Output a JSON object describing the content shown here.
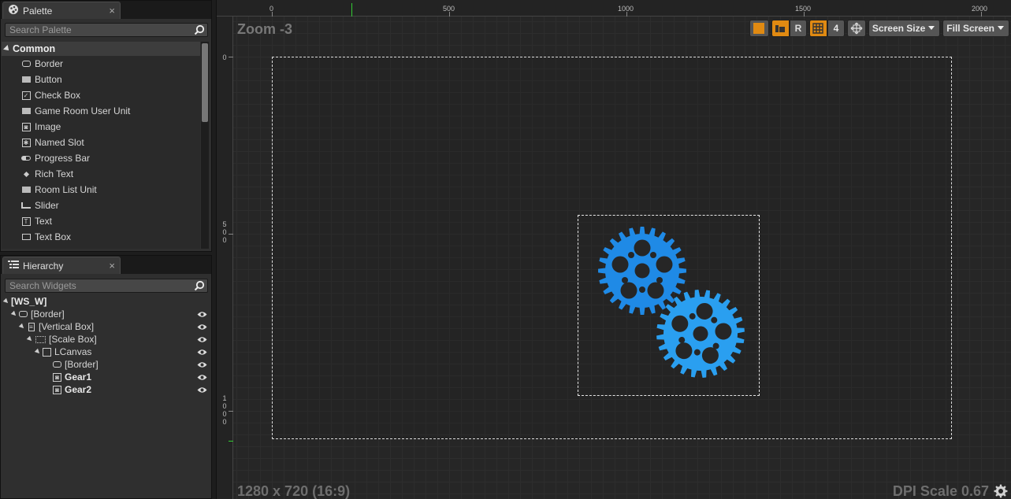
{
  "palette": {
    "tab_label": "Palette",
    "close": "×",
    "search_placeholder": "Search Palette",
    "category": "Common",
    "items": [
      {
        "label": "Border",
        "icon": "border-icon"
      },
      {
        "label": "Button",
        "icon": "button-icon"
      },
      {
        "label": "Check Box",
        "icon": "checkbox-icon"
      },
      {
        "label": "Game Room User Unit",
        "icon": "user-widget-icon"
      },
      {
        "label": "Image",
        "icon": "image-icon"
      },
      {
        "label": "Named Slot",
        "icon": "named-slot-icon"
      },
      {
        "label": "Progress Bar",
        "icon": "progress-bar-icon"
      },
      {
        "label": "Rich Text",
        "icon": "rich-text-icon"
      },
      {
        "label": "Room List Unit",
        "icon": "user-widget-icon"
      },
      {
        "label": "Slider",
        "icon": "slider-icon"
      },
      {
        "label": "Text",
        "icon": "text-icon"
      },
      {
        "label": "Text Box",
        "icon": "text-box-icon"
      }
    ]
  },
  "hierarchy": {
    "tab_label": "Hierarchy",
    "close": "×",
    "search_placeholder": "Search Widgets",
    "items": [
      {
        "label": "[WS_W]",
        "bold": true
      },
      {
        "label": "[Border]"
      },
      {
        "label": "[Vertical Box]"
      },
      {
        "label": "[Scale Box]"
      },
      {
        "label": "LCanvas"
      },
      {
        "label": "[Border]"
      },
      {
        "label": "Gear1",
        "bold": true
      },
      {
        "label": "Gear2",
        "bold": true
      }
    ]
  },
  "designer": {
    "zoom": "Zoom -3",
    "resolution": "1280 x 720 (16:9)",
    "dpi_scale": "DPI Scale 0.67",
    "ruler_top": [
      "0",
      "500",
      "1000",
      "1500",
      "2000"
    ],
    "ruler_left": [
      "0",
      "500",
      "1000"
    ],
    "toolbar": {
      "r_label": "R",
      "grid_snap": "4",
      "screen_size": "Screen Size",
      "fill_screen": "Fill Screen"
    },
    "colors": {
      "accent": "#e08a12",
      "gear1": "#1f8ae6",
      "gear2": "#2a9ff0"
    }
  }
}
